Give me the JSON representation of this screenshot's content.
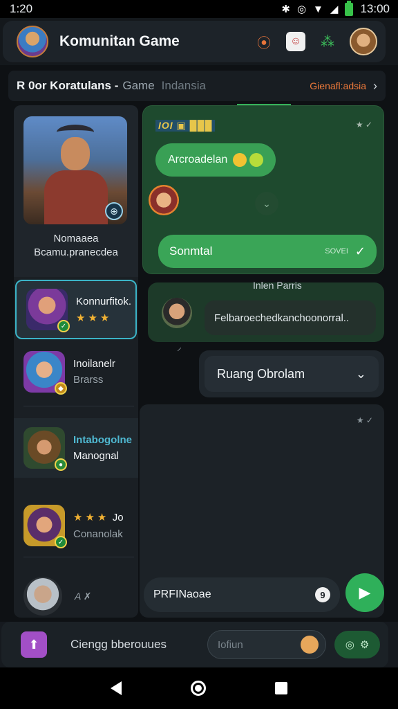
{
  "status": {
    "left_time": "1:20",
    "right_time": "13:00"
  },
  "app": {
    "title": "Komunitan Game"
  },
  "breadcrumb": {
    "part1": "R 0or Koratulans -",
    "part2": "Game",
    "part3": "Indansia",
    "link": "Gienafl:adsia"
  },
  "hero": {
    "name": "Nomaaea",
    "sub": "Bcamu.pranecdea"
  },
  "games": [
    {
      "title": "Konnurfitok.",
      "rating": "★★★"
    },
    {
      "title": "Inoilanelr",
      "sub": "Brarss"
    },
    {
      "title": "Intabogolne",
      "sub": "Manognal"
    },
    {
      "title": "Jo",
      "rating": "★★★",
      "sub": "Conanolak"
    }
  ],
  "chat": {
    "header": "IOI ▣ ███",
    "pill": "Arcroadelan",
    "send_label": "Sonmtal",
    "send_small": "SOVEI"
  },
  "info_label": "Inlen Parris",
  "message": "Felbaroechedkanchoonorral..",
  "room": {
    "label": "Ruang Obrolam"
  },
  "input": {
    "text": "PRFINaoae",
    "icon": "9"
  },
  "me": {
    "label": "A ✗"
  },
  "bottom": {
    "label": "Ciengg bberouues",
    "search_placeholder": "Iofiun"
  },
  "icons": {
    "people_orange": "people-icon",
    "bot": "bot-icon",
    "people_green": "group-icon",
    "menu": "more-icon"
  }
}
